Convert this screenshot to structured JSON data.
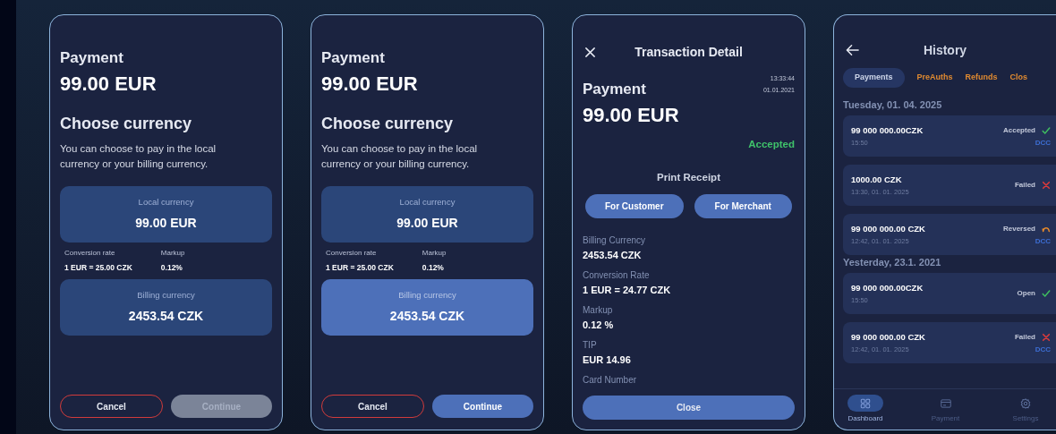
{
  "screens": [
    {
      "kind": "currency",
      "title": "Payment",
      "amount": "99.00 EUR",
      "heading": "Choose currency",
      "description": "You can choose to pay in the local currency or your billing currency.",
      "options": [
        {
          "label": "Local currency",
          "value": "99.00 EUR",
          "selected": false
        },
        {
          "label": "Billing currency",
          "value": "2453.54 CZK",
          "selected": false
        }
      ],
      "rate": {
        "label": "Conversion rate",
        "value": "1 EUR = 25.00 CZK"
      },
      "markup": {
        "label": "Markup",
        "value": "0.12%"
      },
      "cancel": "Cancel",
      "continue": {
        "label": "Continue",
        "disabled": true
      }
    },
    {
      "kind": "currency",
      "title": "Payment",
      "amount": "99.00 EUR",
      "heading": "Choose currency",
      "description": "You can choose to pay in the local currency or your billing currency.",
      "options": [
        {
          "label": "Local currency",
          "value": "99.00 EUR",
          "selected": false
        },
        {
          "label": "Billing currency",
          "value": "2453.54 CZK",
          "selected": true
        }
      ],
      "rate": {
        "label": "Conversion rate",
        "value": "1 EUR = 25.00 CZK"
      },
      "markup": {
        "label": "Markup",
        "value": "0.12%"
      },
      "cancel": "Cancel",
      "continue": {
        "label": "Continue",
        "disabled": false
      }
    },
    {
      "kind": "detail",
      "title": "Transaction Detail",
      "type": "Payment",
      "time": "13:33:44",
      "date": "01.01.2021",
      "amount": "99.00 EUR",
      "status": "Accepted",
      "print_label": "Print Receipt",
      "print_buttons": [
        "For Customer",
        "For Merchant"
      ],
      "fields": [
        {
          "label": "Billing Currency",
          "value": "2453.54 CZK"
        },
        {
          "label": "Conversion Rate",
          "value": "1 EUR = 24.77 CZK"
        },
        {
          "label": "Markup",
          "value": "0.12 %"
        },
        {
          "label": "TIP",
          "value": "EUR 14.96"
        },
        {
          "label": "Card Number"
        }
      ],
      "close": "Close"
    },
    {
      "kind": "history",
      "title": "History",
      "tabs": [
        {
          "label": "Payments",
          "selected": true
        },
        {
          "label": "PreAuths",
          "selected": false
        },
        {
          "label": "Refunds",
          "selected": false
        },
        {
          "label": "Clos",
          "selected": false
        }
      ],
      "groups": [
        {
          "date": "Tuesday, 01. 04. 2025",
          "items": [
            {
              "amount": "99 000 000.00CZK",
              "time": "15:50",
              "status": "Accepted",
              "kind": "accepted",
              "badge": "DCC"
            },
            {
              "amount": "1000.00 CZK",
              "time": "13:30, 01. 01. 2025",
              "status": "Failed",
              "kind": "failed"
            },
            {
              "amount": "99 000 000.00 CZK",
              "time": "12:42, 01. 01. 2025",
              "status": "Reversed",
              "kind": "reversed",
              "badge": "DCC"
            }
          ]
        },
        {
          "date": "Yesterday, 23.1. 2021",
          "items": [
            {
              "amount": "99 000 000.00CZK",
              "time": "15:50",
              "status": "Open",
              "kind": "open"
            },
            {
              "amount": "99 000 000.00 CZK",
              "time": "12:42, 01. 01. 2025",
              "status": "Failed",
              "kind": "failed",
              "badge": "DCC"
            }
          ]
        }
      ],
      "nav": [
        {
          "label": "Dashboard",
          "selected": true
        },
        {
          "label": "Payment",
          "selected": false
        },
        {
          "label": "Settings",
          "selected": false
        }
      ]
    }
  ]
}
